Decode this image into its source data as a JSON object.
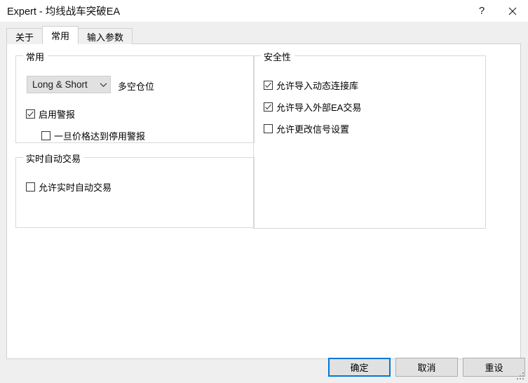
{
  "window": {
    "title": "Expert - 均线战车突破EA",
    "help_icon": "question-mark-icon",
    "close_icon": "close-icon"
  },
  "tabs": [
    {
      "label": "关于",
      "selected": false
    },
    {
      "label": "常用",
      "selected": true
    },
    {
      "label": "输入参数",
      "selected": false
    }
  ],
  "groups": {
    "common": {
      "title": "常用",
      "position_combo": {
        "value": "Long & Short",
        "arrow_icon": "chevron-down-icon",
        "label": "多空仓位"
      },
      "enable_alert": {
        "label": "启用警报",
        "checked": true
      },
      "disable_alert_on_price": {
        "label": "一旦价格达到停用警报",
        "checked": false
      }
    },
    "live_trading": {
      "title": "实时自动交易",
      "allow_live": {
        "label": "允许实时自动交易",
        "checked": false
      }
    },
    "safety": {
      "title": "安全性",
      "allow_dll_import": {
        "label": "允许导入动态连接库",
        "checked": true
      },
      "allow_external_ea_import": {
        "label": "允许导入外部EA交易",
        "checked": true
      },
      "allow_signal_change": {
        "label": "允许更改信号设置",
        "checked": false
      }
    }
  },
  "footer": {
    "ok_label": "确定",
    "cancel_label": "取消",
    "reset_label": "重设"
  },
  "colors": {
    "accent": "#0078d7",
    "window_bg": "#efefef",
    "panel_bg": "#ffffff",
    "button_face": "#e1e1e1"
  }
}
